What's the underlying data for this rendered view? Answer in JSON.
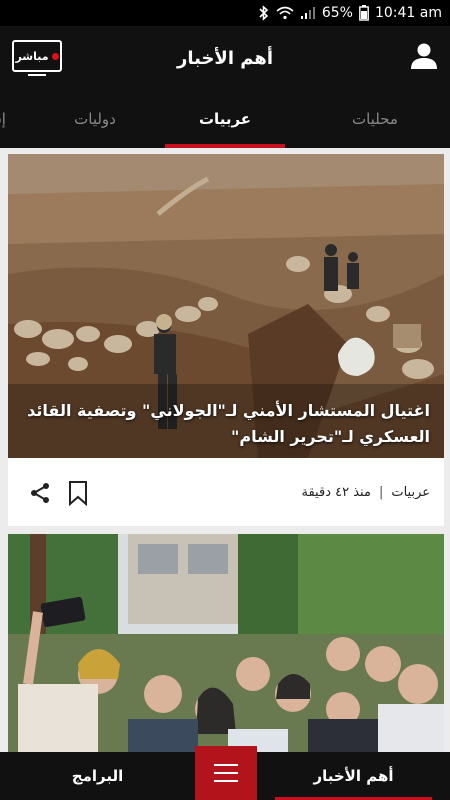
{
  "status": {
    "battery": "65%",
    "time": "10:41 am"
  },
  "header": {
    "title": "أهم الأخبار",
    "live_label": "مباشر"
  },
  "tabs": [
    {
      "label": "محليات",
      "active": false
    },
    {
      "label": "عربيات",
      "active": true
    },
    {
      "label": "دوليات",
      "active": false
    },
    {
      "label": "إق",
      "active": false
    }
  ],
  "articles": [
    {
      "headline": "اغتيال المستشار الأمني لـ\"الجولاني\" وتصفية القائد العسكري لـ\"تحرير الشام\"",
      "category": "عربيات",
      "time": "منذ ٤٢ دقيقة",
      "separator": "|"
    }
  ],
  "bottom_nav": {
    "top_news": "أهم الأخبار",
    "programs": "البرامج"
  },
  "colors": {
    "accent": "#c8101e",
    "bar": "#111111",
    "background": "#ececec"
  },
  "icons": [
    "wifi-icon",
    "signal-icon",
    "battery-icon",
    "bluetooth-icon",
    "user-icon",
    "share-icon",
    "bookmark-icon",
    "menu-icon"
  ]
}
